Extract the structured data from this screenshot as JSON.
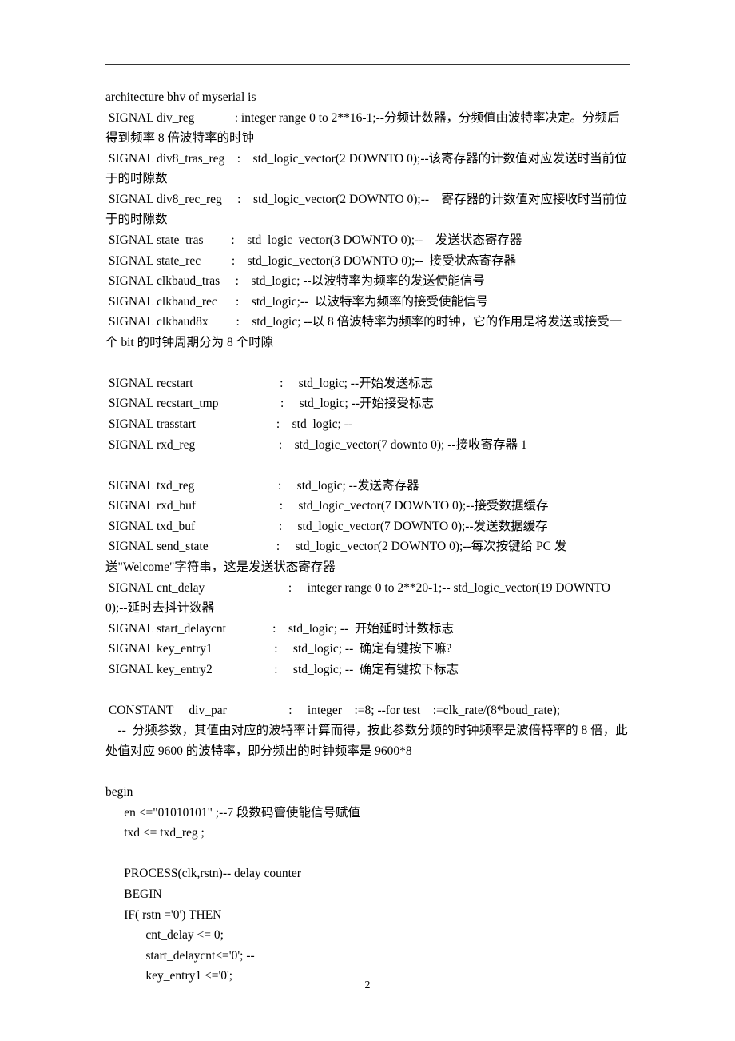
{
  "page_number": "2",
  "code": {
    "l01": "architecture bhv of myserial is",
    "l02": " SIGNAL div_reg             : integer range 0 to 2**16-1;--分频计数器，分频值由波特率决定。分频后得到频率 8 倍波特率的时钟",
    "l03": " SIGNAL div8_tras_reg    :    std_logic_vector(2 DOWNTO 0);--该寄存器的计数值对应发送时当前位于的时隙数",
    "l04": " SIGNAL div8_rec_reg     :    std_logic_vector(2 DOWNTO 0);--    寄存器的计数值对应接收时当前位于的时隙数",
    "l05": " SIGNAL state_tras         :    std_logic_vector(3 DOWNTO 0);--    发送状态寄存器",
    "l06": " SIGNAL state_rec          :    std_logic_vector(3 DOWNTO 0);--  接受状态寄存器",
    "l07": " SIGNAL clkbaud_tras     :    std_logic; --以波特率为频率的发送使能信号",
    "l08": " SIGNAL clkbaud_rec      :    std_logic;--  以波特率为频率的接受使能信号",
    "l09": " SIGNAL clkbaud8x         :    std_logic; --以 8 倍波特率为频率的时钟，它的作用是将发送或接受一个 bit 的时钟周期分为 8 个时隙",
    "l10": "",
    "l11": " SIGNAL recstart                            :     std_logic; --开始发送标志",
    "l12": " SIGNAL recstart_tmp                    :     std_logic; --开始接受标志",
    "l13": " SIGNAL trasstart                          :    std_logic; --",
    "l14": " SIGNAL rxd_reg                           :    std_logic_vector(7 downto 0); --接收寄存器 1",
    "l15": "",
    "l16": " SIGNAL txd_reg                           :     std_logic; --发送寄存器",
    "l17": " SIGNAL rxd_buf                           :     std_logic_vector(7 DOWNTO 0);--接受数据缓存",
    "l18": " SIGNAL txd_buf                           :     std_logic_vector(7 DOWNTO 0);--发送数据缓存",
    "l19": " SIGNAL send_state                      :     std_logic_vector(2 DOWNTO 0);--每次按键给 PC 发送\"Welcome\"字符串，这是发送状态寄存器",
    "l20": " SIGNAL cnt_delay                           :     integer range 0 to 2**20-1;-- std_logic_vector(19 DOWNTO 0);--延时去抖计数器",
    "l21": " SIGNAL start_delaycnt               :    std_logic; --  开始延时计数标志",
    "l22": " SIGNAL key_entry1                    :     std_logic; --  确定有键按下嘛?",
    "l23": " SIGNAL key_entry2                    :     std_logic; --  确定有键按下标志",
    "l24": "",
    "l25": " CONSTANT     div_par                    :     integer    :=8; --for test    :=clk_rate/(8*boud_rate);",
    "l26": "    --  分频参数，其值由对应的波特率计算而得，按此参数分频的时钟频率是波倍特率的 8 倍，此处值对应 9600 的波特率，即分频出的时钟频率是 9600*8",
    "l27": "",
    "l28": "begin",
    "l29": "      en <=\"01010101\" ;--7 段数码管使能信号赋值",
    "l30": "      txd <= txd_reg ;",
    "l31": "",
    "l32": "      PROCESS(clk,rstn)-- delay counter",
    "l33": "      BEGIN",
    "l34": "      IF( rstn ='0') THEN",
    "l35": "             cnt_delay <= 0;",
    "l36": "             start_delaycnt<='0'; --",
    "l37": "             key_entry1 <='0';"
  }
}
